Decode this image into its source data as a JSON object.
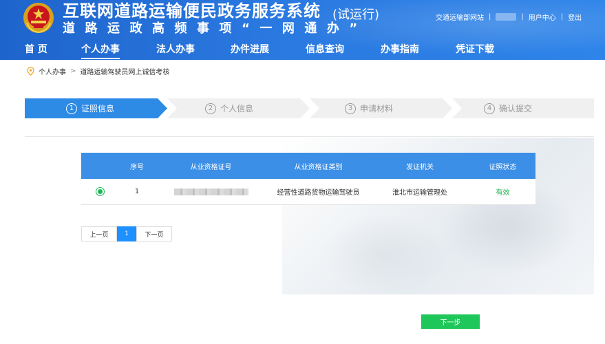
{
  "header": {
    "title": "互联网道路运输便民政务服务系统",
    "trial": "(试运行)",
    "subtitle": "道路运政高频事项“一网通办”",
    "links": {
      "ministry": "交通运输部网站",
      "user_center": "用户中心",
      "logout": "登出"
    }
  },
  "nav": {
    "items": [
      {
        "label": "首 页"
      },
      {
        "label": "个人办事"
      },
      {
        "label": "法人办事"
      },
      {
        "label": "办件进展"
      },
      {
        "label": "信息查询"
      },
      {
        "label": "办事指南"
      },
      {
        "label": "凭证下载"
      }
    ],
    "active_index": 1
  },
  "breadcrumb": {
    "items": [
      "个人办事",
      "道路运输驾驶员网上诚信考核"
    ],
    "separator": ">"
  },
  "steps": [
    {
      "num": "1",
      "label": "证照信息",
      "active": true
    },
    {
      "num": "2",
      "label": "个人信息",
      "active": false
    },
    {
      "num": "3",
      "label": "申请材料",
      "active": false
    },
    {
      "num": "4",
      "label": "确认提交",
      "active": false
    }
  ],
  "table": {
    "columns": [
      "",
      "序号",
      "从业资格证号",
      "从业资格证类别",
      "发证机关",
      "证照状态"
    ],
    "rows": [
      {
        "selected": true,
        "index": "1",
        "cert_number": "",
        "category": "经营性道路货物运输驾驶员",
        "issuer": "淮北市运输管理处",
        "status": "有效"
      }
    ]
  },
  "pagination": {
    "prev": "上一页",
    "current": "1",
    "next": "下一页"
  },
  "actions": {
    "next_step": "下一步"
  },
  "colors": {
    "primary": "#2a79e0",
    "table_header": "#3c8fe6",
    "success": "#1fc75a",
    "status_valid": "#1fb34c"
  },
  "icons": {
    "emblem": "national-emblem-icon",
    "location": "location-pin-icon",
    "radio": "radio-selected-icon"
  }
}
